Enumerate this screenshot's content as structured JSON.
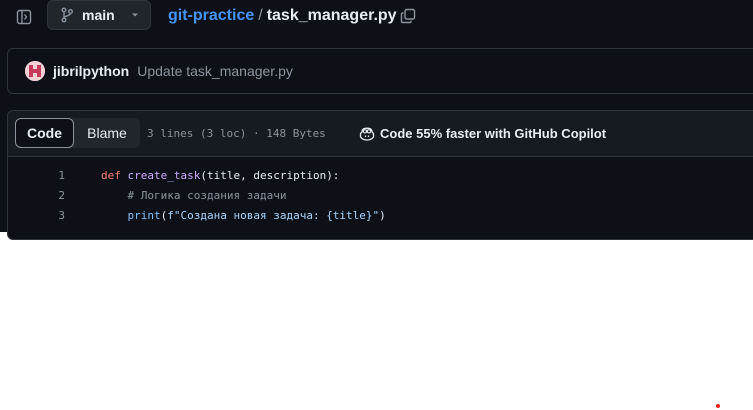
{
  "branch": {
    "name": "main",
    "icon": "git-branch-icon"
  },
  "breadcrumb": {
    "repo": "git-practice",
    "separator": "/",
    "file": "task_manager.py"
  },
  "commit": {
    "author": "jibrilpython",
    "message": "Update task_manager.py"
  },
  "file_view": {
    "tabs": [
      "Code",
      "Blame"
    ],
    "active_tab": "Code",
    "info": "3 lines (3 loc) · 148 Bytes",
    "copilot_text": "Code 55% faster with GitHub Copilot"
  },
  "code": {
    "lines": [
      {
        "number": "1",
        "tokens": [
          {
            "t": "def",
            "c": "kw"
          },
          {
            "t": " ",
            "c": ""
          },
          {
            "t": "create_task",
            "c": "fn"
          },
          {
            "t": "(title, description):",
            "c": ""
          }
        ]
      },
      {
        "number": "2",
        "tokens": [
          {
            "t": "    ",
            "c": ""
          },
          {
            "t": "# Логика создания задачи",
            "c": "cm"
          }
        ]
      },
      {
        "number": "3",
        "tokens": [
          {
            "t": "    ",
            "c": ""
          },
          {
            "t": "print",
            "c": "bi"
          },
          {
            "t": "(",
            "c": ""
          },
          {
            "t": "f\"Создана новая задача: {title}\"",
            "c": "st"
          },
          {
            "t": ")",
            "c": ""
          }
        ]
      }
    ]
  },
  "colors": {
    "background": "#0d1117",
    "link": "#4493f8",
    "muted": "#8b949e",
    "keyword": "#ff7b72",
    "function": "#d2a8ff",
    "string": "#a5d6ff"
  }
}
